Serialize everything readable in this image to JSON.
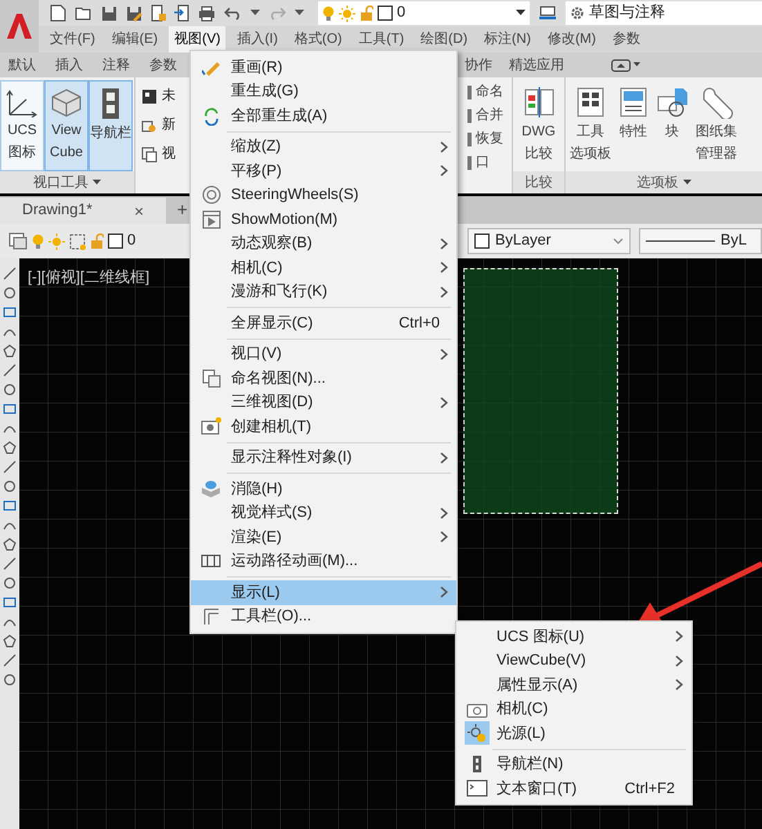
{
  "quick_access": {
    "layer": "0",
    "workspace": "草图与注释"
  },
  "menubar": [
    {
      "label": "文件(F)",
      "selected": false
    },
    {
      "label": "编辑(E)",
      "selected": false
    },
    {
      "label": "视图(V)",
      "selected": true
    },
    {
      "label": "插入(I)",
      "selected": false
    },
    {
      "label": "格式(O)",
      "selected": false
    },
    {
      "label": "工具(T)",
      "selected": false
    },
    {
      "label": "绘图(D)",
      "selected": false
    },
    {
      "label": "标注(N)",
      "selected": false
    },
    {
      "label": "修改(M)",
      "selected": false
    },
    {
      "label": "参数",
      "selected": false
    }
  ],
  "ribbon_tabs": [
    "默认",
    "插入",
    "注释",
    "参数",
    "协作",
    "精选应用"
  ],
  "ribbon": {
    "viewport_tools": {
      "title": "视口工具",
      "buttons": [
        {
          "lines": [
            "UCS",
            "图标"
          ],
          "on": false
        },
        {
          "lines": [
            "View",
            "Cube"
          ],
          "on": true
        },
        {
          "lines": [
            "导航栏"
          ],
          "on": true
        }
      ]
    },
    "view_items": [
      "未",
      "新",
      "视"
    ],
    "view_items_right": [
      "命名",
      "合并",
      "恢复",
      "口"
    ],
    "compare": {
      "lines": [
        "DWG",
        "比较"
      ],
      "title": "比较"
    },
    "palettes": {
      "title": "选项板",
      "buttons": [
        {
          "lines": [
            "工具",
            "选项板"
          ]
        },
        {
          "lines": [
            "特性"
          ]
        },
        {
          "lines": [
            "块"
          ]
        },
        {
          "lines": [
            "图纸集",
            "管理器"
          ]
        }
      ]
    }
  },
  "file_tabs": [
    {
      "label": "Drawing1*",
      "selected": true
    }
  ],
  "tab_close": "×",
  "new_tab": "+",
  "properties_bar": {
    "layer": "0",
    "color_setting": "ByLayer",
    "linetype": "ByL"
  },
  "viewport": {
    "label": "[-][俯视][二维线框]"
  },
  "view_menu": [
    {
      "kind": "item",
      "label": "重画(R)",
      "selected": false
    },
    {
      "kind": "item",
      "label": "重生成(G)",
      "selected": false
    },
    {
      "kind": "item",
      "label": "全部重生成(A)",
      "selected": false
    },
    {
      "kind": "separator"
    },
    {
      "kind": "item",
      "label": "缩放(Z)",
      "submenu": true,
      "selected": false
    },
    {
      "kind": "item",
      "label": "平移(P)",
      "submenu": true,
      "selected": false
    },
    {
      "kind": "item",
      "label": "SteeringWheels(S)",
      "selected": false
    },
    {
      "kind": "item",
      "label": "ShowMotion(M)",
      "selected": false
    },
    {
      "kind": "item",
      "label": "动态观察(B)",
      "submenu": true,
      "selected": false
    },
    {
      "kind": "item",
      "label": "相机(C)",
      "submenu": true,
      "selected": false
    },
    {
      "kind": "item",
      "label": "漫游和飞行(K)",
      "submenu": true,
      "selected": false
    },
    {
      "kind": "separator"
    },
    {
      "kind": "item",
      "label": "全屏显示(C)",
      "shortcut": "Ctrl+0",
      "selected": false
    },
    {
      "kind": "separator"
    },
    {
      "kind": "item",
      "label": "视口(V)",
      "submenu": true,
      "selected": false
    },
    {
      "kind": "item",
      "label": "命名视图(N)...",
      "selected": false
    },
    {
      "kind": "item",
      "label": "三维视图(D)",
      "submenu": true,
      "selected": false
    },
    {
      "kind": "item",
      "label": "创建相机(T)",
      "selected": false
    },
    {
      "kind": "separator"
    },
    {
      "kind": "item",
      "label": "显示注释性对象(I)",
      "submenu": true,
      "selected": false
    },
    {
      "kind": "separator"
    },
    {
      "kind": "item",
      "label": "消隐(H)",
      "selected": false
    },
    {
      "kind": "item",
      "label": "视觉样式(S)",
      "submenu": true,
      "selected": false
    },
    {
      "kind": "item",
      "label": "渲染(E)",
      "submenu": true,
      "selected": false
    },
    {
      "kind": "item",
      "label": "运动路径动画(M)...",
      "selected": false
    },
    {
      "kind": "separator"
    },
    {
      "kind": "item",
      "label": "显示(L)",
      "submenu": true,
      "selected": true
    },
    {
      "kind": "item",
      "label": "工具栏(O)...",
      "selected": false
    }
  ],
  "display_submenu": [
    {
      "kind": "item",
      "label": "UCS 图标(U)",
      "submenu": true,
      "selected": false,
      "checked": false
    },
    {
      "kind": "item",
      "label": "ViewCube(V)",
      "submenu": true,
      "selected": false,
      "checked": false
    },
    {
      "kind": "item",
      "label": "属性显示(A)",
      "submenu": true,
      "selected": false,
      "checked": false
    },
    {
      "kind": "item",
      "label": "相机(C)",
      "selected": false,
      "checked": false
    },
    {
      "kind": "item",
      "label": "光源(L)",
      "selected": false,
      "checked": true
    },
    {
      "kind": "separator"
    },
    {
      "kind": "item",
      "label": "导航栏(N)",
      "selected": false,
      "checked": false
    },
    {
      "kind": "item",
      "label": "文本窗口(T)",
      "shortcut": "Ctrl+F2",
      "selected": false,
      "checked": false
    }
  ]
}
